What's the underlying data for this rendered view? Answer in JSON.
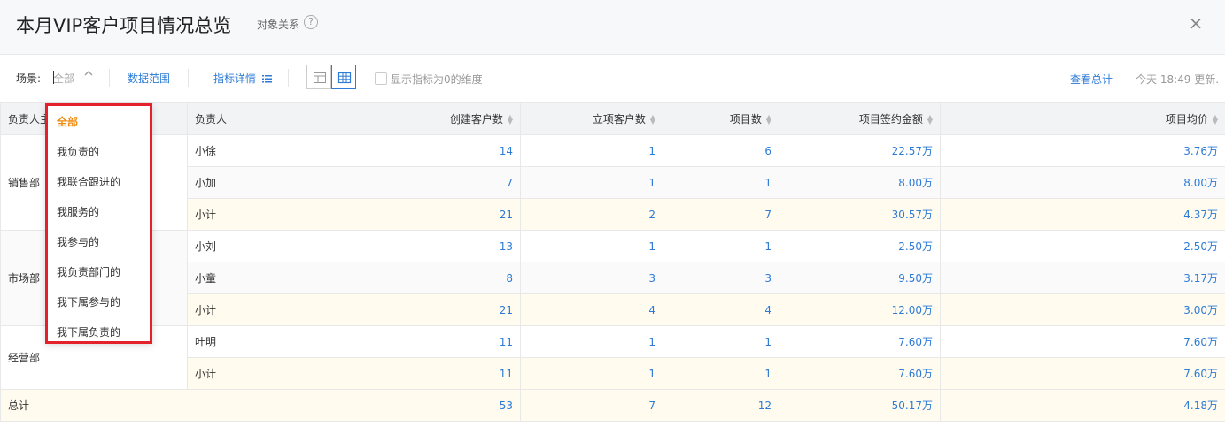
{
  "header": {
    "title": "本月VIP客户项目情况总览",
    "sub_link": "对象关系",
    "help": "?",
    "close": "×"
  },
  "toolbar": {
    "scene_label": "场景:",
    "scene_value": "全部",
    "data_range": "数据范围",
    "metric_detail": "指标详情",
    "show_zero_label": "显示指标为0的维度",
    "view_total": "查看总计",
    "updated": "今天 18:49 更新."
  },
  "scene_options": [
    "全部",
    "我负责的",
    "我联合跟进的",
    "我服务的",
    "我参与的",
    "我负责部门的",
    "我下属参与的",
    "我下属负责的"
  ],
  "table": {
    "columns": [
      "负责人主",
      "负责人",
      "创建客户数",
      "立项客户数",
      "项目数",
      "项目签约金额",
      "项目均价"
    ],
    "rows": [
      {
        "dept": "销售部",
        "owner": "小徐",
        "created": "14",
        "approved": "1",
        "projects": "6",
        "amount": "22.57万",
        "avg": "3.76万"
      },
      {
        "dept": "",
        "owner": "小加",
        "created": "7",
        "approved": "1",
        "projects": "1",
        "amount": "8.00万",
        "avg": "8.00万"
      },
      {
        "dept": "",
        "owner": "小计",
        "created": "21",
        "approved": "2",
        "projects": "7",
        "amount": "30.57万",
        "avg": "4.37万"
      },
      {
        "dept": "市场部",
        "owner": "小刘",
        "created": "13",
        "approved": "1",
        "projects": "1",
        "amount": "2.50万",
        "avg": "2.50万"
      },
      {
        "dept": "",
        "owner": "小童",
        "created": "8",
        "approved": "3",
        "projects": "3",
        "amount": "9.50万",
        "avg": "3.17万"
      },
      {
        "dept": "",
        "owner": "小计",
        "created": "21",
        "approved": "4",
        "projects": "4",
        "amount": "12.00万",
        "avg": "3.00万"
      },
      {
        "dept": "经营部",
        "owner": "叶明",
        "created": "11",
        "approved": "1",
        "projects": "1",
        "amount": "7.60万",
        "avg": "7.60万"
      },
      {
        "dept": "",
        "owner": "小计",
        "created": "11",
        "approved": "1",
        "projects": "1",
        "amount": "7.60万",
        "avg": "7.60万"
      }
    ],
    "grand_total": {
      "label": "总计",
      "created": "53",
      "approved": "7",
      "projects": "12",
      "amount": "50.17万",
      "avg": "4.18万"
    }
  },
  "colors": {
    "link": "#2d7bd6",
    "highlight_border": "#e4202a",
    "selected_option": "#f08a0c",
    "subtotal_bg": "#fffbee"
  },
  "icons": [
    "help-icon",
    "close-icon",
    "chevron-up-icon",
    "list-icon",
    "table-view-icon",
    "grid-view-icon",
    "sort-icon"
  ]
}
